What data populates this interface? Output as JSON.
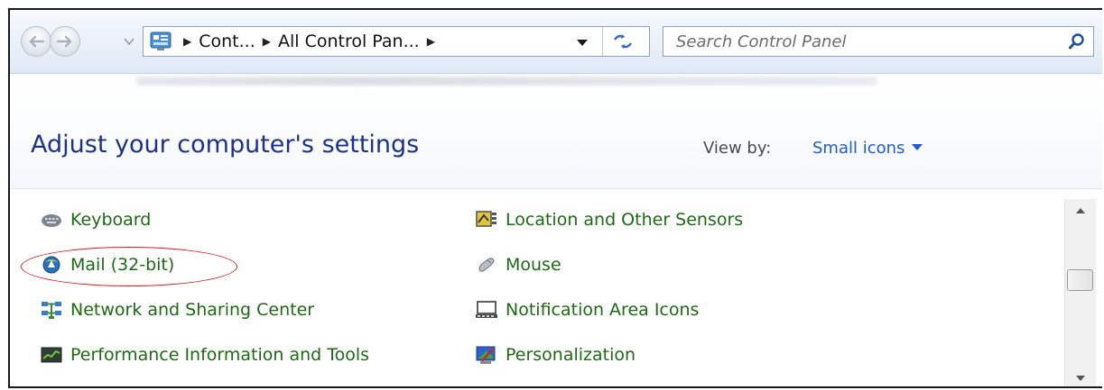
{
  "breadcrumb": {
    "items": [
      "Cont...",
      "All Control Pan..."
    ]
  },
  "search": {
    "placeholder": "Search Control Panel"
  },
  "header": {
    "title": "Adjust your computer's settings",
    "view_by_label": "View by:",
    "view_by_value": "Small icons"
  },
  "items": {
    "keyboard": "Keyboard",
    "location": "Location and Other Sensors",
    "mail": "Mail (32-bit)",
    "mouse": "Mouse",
    "network": "Network and Sharing Center",
    "notification": "Notification Area Icons",
    "performance": "Performance Information and Tools",
    "personalization": "Personalization"
  },
  "colors": {
    "link_green": "#1d6a14",
    "title_blue": "#1e3287",
    "accent_blue": "#1f5bd0",
    "highlight_red": "#d81e1e"
  },
  "icons": {
    "back": "back-arrow-icon",
    "forward": "forward-arrow-icon",
    "refresh": "refresh-icon",
    "search": "search-icon"
  }
}
